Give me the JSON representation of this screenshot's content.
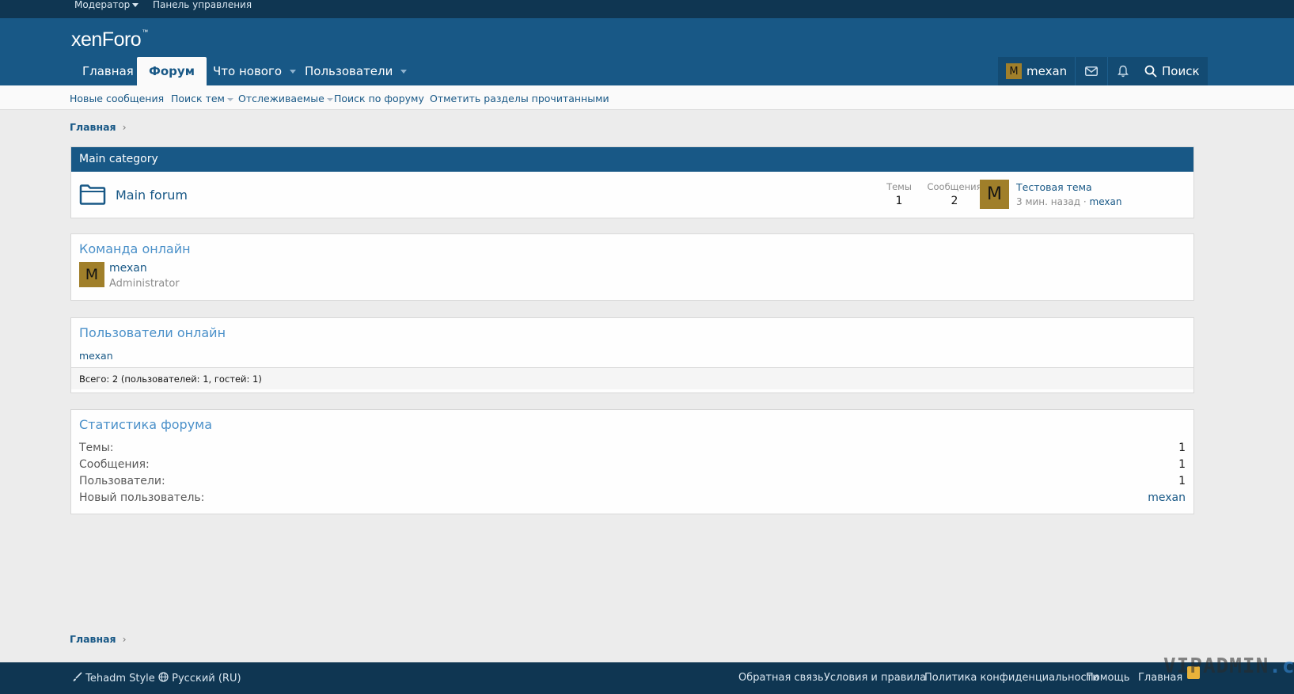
{
  "staff_bar": {
    "moderator": "Модератор",
    "admin_panel": "Панель управления"
  },
  "header": {
    "logo": "xenForo",
    "logo_mark": "™",
    "tabs": [
      "Главная",
      "Форум",
      "Что нового",
      "Пользователи"
    ],
    "active_tab": "Форум",
    "user": {
      "avatar_letter": "M",
      "name": "mexan"
    },
    "search_label": "Поиск",
    "icons": [
      "envelope-icon",
      "bell-icon",
      "search-icon"
    ]
  },
  "subnav": {
    "items": [
      "Новые сообщения",
      "Поиск тем",
      "Отслеживаемые",
      "Поиск по форуму",
      "Отметить разделы прочитанными"
    ]
  },
  "breadcrumb": {
    "home": "Главная"
  },
  "category": {
    "title": "Main category",
    "forum": {
      "name": "Main forum",
      "threads_label": "Темы",
      "threads": "1",
      "messages_label": "Сообщения",
      "messages": "2",
      "last_post": {
        "avatar_letter": "M",
        "title": "Тестовая тема",
        "time": "3 мин. назад",
        "separator": "·",
        "user": "mexan"
      }
    }
  },
  "staff_online": {
    "title": "Команда онлайн",
    "member": {
      "avatar_letter": "M",
      "name": "mexan",
      "role": "Administrator"
    }
  },
  "users_online": {
    "title": "Пользователи онлайн",
    "list": "mexan",
    "total": "Всего: 2 (пользователей: 1, гостей: 1)"
  },
  "forum_stats": {
    "title": "Статистика форума",
    "rows": [
      {
        "key": "Темы:",
        "value": "1"
      },
      {
        "key": "Сообщения:",
        "value": "1"
      },
      {
        "key": "Пользователи:",
        "value": "1"
      },
      {
        "key": "Новый пользователь:",
        "value": "mexan"
      }
    ]
  },
  "footer": {
    "style": "Tehadm Style",
    "language": "Русский (RU)",
    "links": [
      "Обратная связь",
      "Условия и правила",
      "Политика конфиденциальности",
      "Помощь",
      "Главная"
    ],
    "watermark_a": "VIPADMIN",
    "watermark_b": ".club"
  },
  "colors": {
    "header": "#185886",
    "staff_bar": "#0f3652",
    "accent_link": "#4a90c9",
    "avatar": "#a07f2a"
  }
}
